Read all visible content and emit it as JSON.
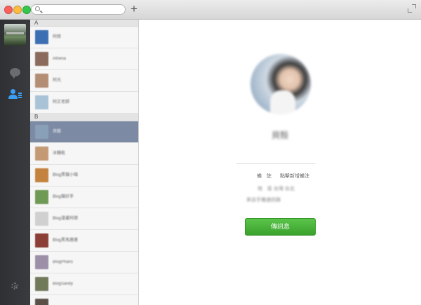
{
  "search": {
    "placeholder": "",
    "value": ""
  },
  "sections": [
    "A",
    "B"
  ],
  "contacts": [
    {
      "name": "阿修",
      "avatar": "#3d6fb3"
    },
    {
      "name": "Athena",
      "avatar": "#8a6a5c"
    },
    {
      "name": "阿光",
      "avatar": "#b48e74"
    },
    {
      "name": "阿正老師",
      "avatar": "#a8c2d6"
    },
    {
      "name": "貝殼",
      "avatar": "#8aa0b8"
    },
    {
      "name": "冰糖乾",
      "avatar": "#c49a74"
    },
    {
      "name": "Blog黑貓小喵",
      "avatar": "#c4823f"
    },
    {
      "name": "Blog貓好手",
      "avatar": "#6f9a56"
    },
    {
      "name": "Blog漫畫阿德",
      "avatar": "#d0d0d0"
    },
    {
      "name": "Blog黑馬唐唐",
      "avatar": "#8b3f36"
    },
    {
      "name": "BlogPharis",
      "avatar": "#9c8fa8"
    },
    {
      "name": "BlogSandy",
      "avatar": "#707a5a"
    },
    {
      "name": "",
      "avatar": "#5a5048"
    }
  ],
  "selected_index": 4,
  "profile": {
    "name": "貝殼",
    "memo_label": "備　註",
    "memo_value": "點擊新增備注",
    "line2": "地　區 台灣 台北",
    "line3": "來自手機通訊錄"
  },
  "send_button": "傳訊息",
  "colors": {
    "accent": "#3a9ef5",
    "send": "#4bb63b",
    "selected_row": "#7c8aa4"
  }
}
